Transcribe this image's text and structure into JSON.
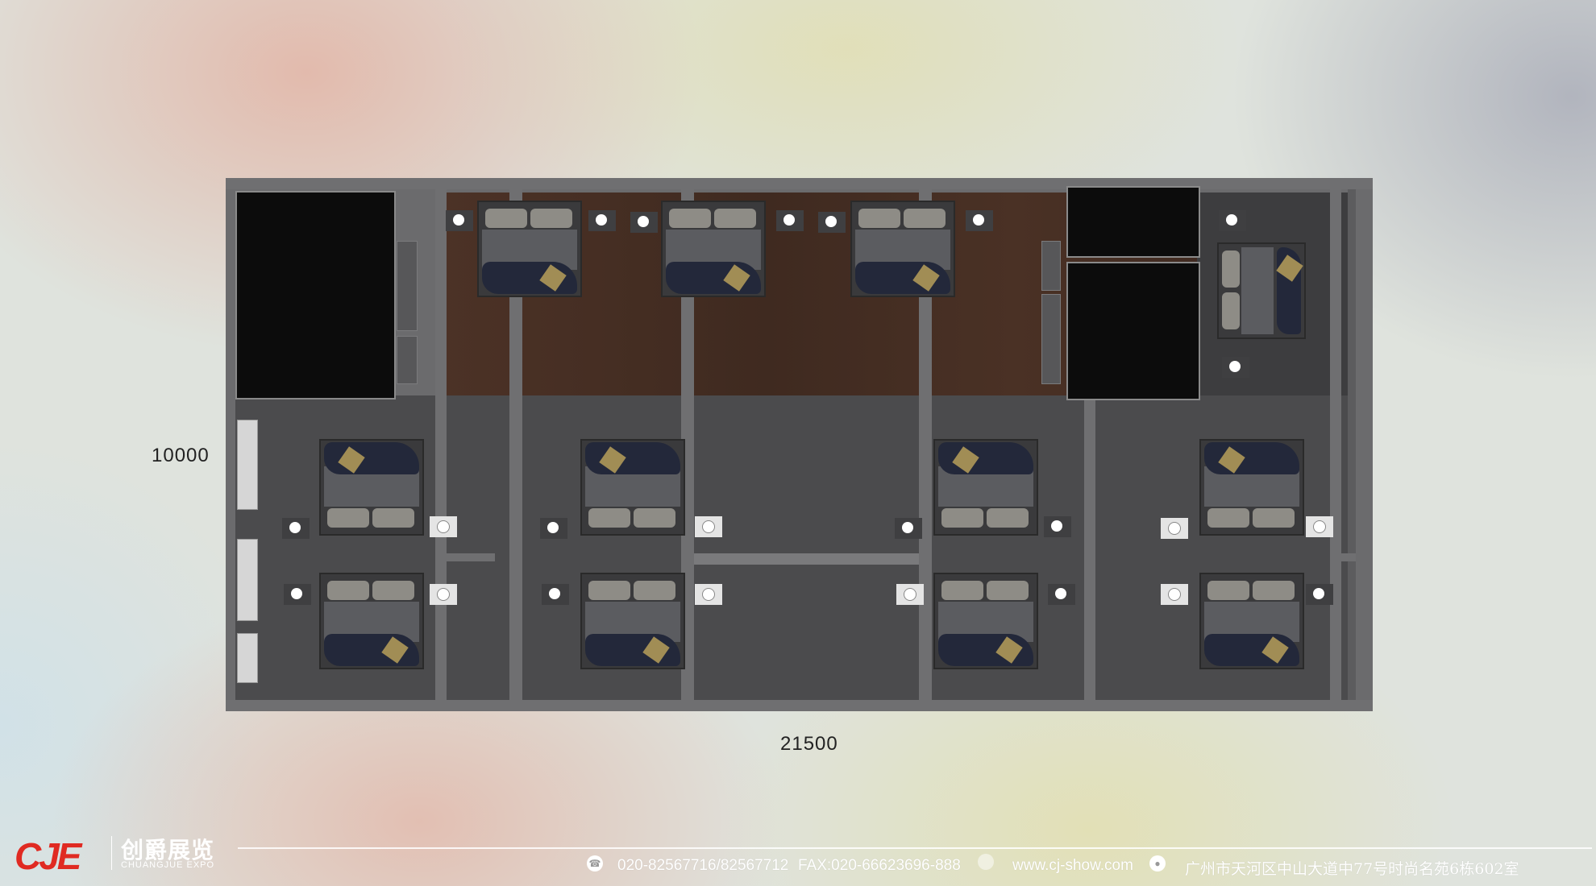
{
  "dimensions": {
    "height_label": "10000",
    "width_label": "21500"
  },
  "footer": {
    "logo_mark": "CJE",
    "logo_cn": "创爵展览",
    "logo_en": "CHUANGJUE EXPO",
    "phone": "020-82567716/82567712",
    "fax": "FAX:020-66623696-888",
    "website": "www.cj-show.com",
    "address": "广州市天河区中山大道中77号时尚名苑6栋602室"
  },
  "icons": [
    "phone-icon",
    "globe-icon",
    "location-pin-icon"
  ],
  "colors": {
    "brand_red": "#e02a22"
  }
}
